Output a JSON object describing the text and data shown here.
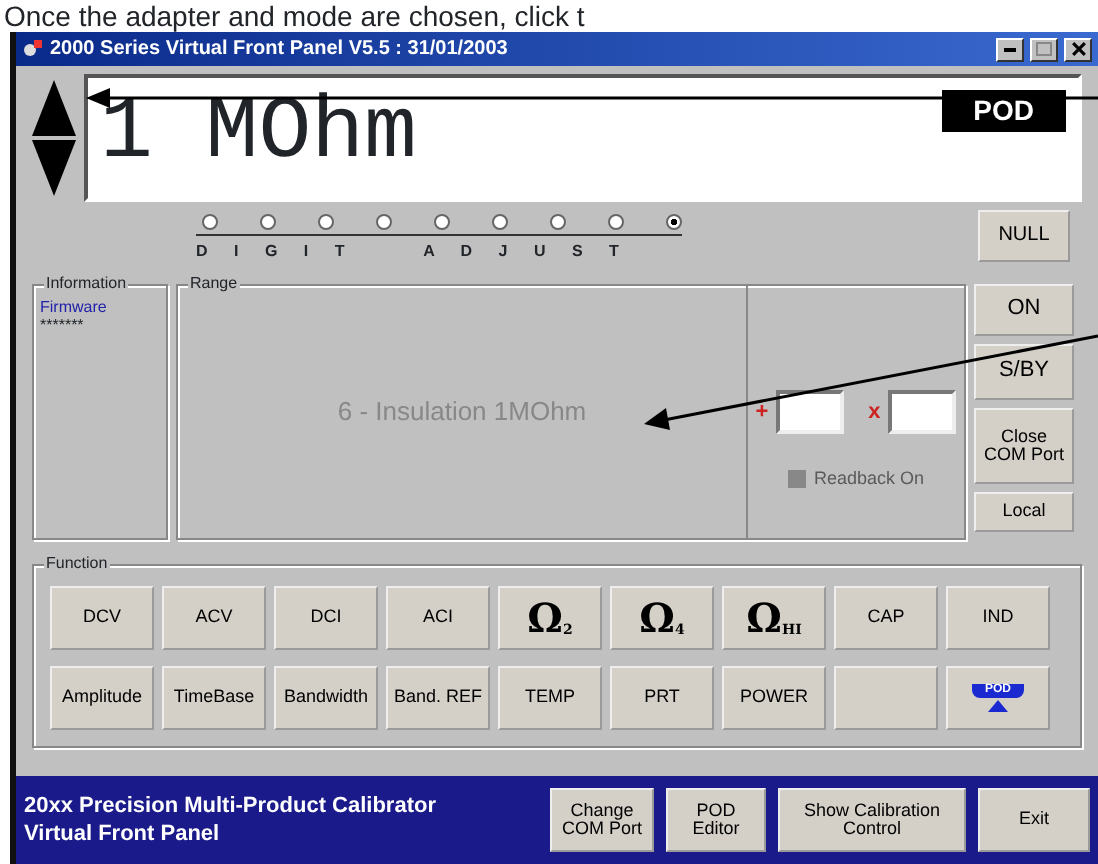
{
  "caption": "Once the adapter and mode are chosen, click t",
  "window": {
    "title": "2000 Series Virtual Front Panel V5.5 : 31/01/2003"
  },
  "display": {
    "reading": "1 MOhm",
    "badge": "POD"
  },
  "digit_adjust": {
    "label": "D I G I T   A D J U S T",
    "radios": [
      {
        "selected": false
      },
      {
        "selected": false
      },
      {
        "selected": false
      },
      {
        "selected": false
      },
      {
        "selected": false
      },
      {
        "selected": false
      },
      {
        "selected": false
      },
      {
        "selected": false
      },
      {
        "selected": true
      }
    ]
  },
  "null_button": "NULL",
  "information": {
    "title": "Information",
    "link": "Firmware",
    "value": "*******"
  },
  "range": {
    "title": "Range",
    "text": "6 - Insulation 1MOhm",
    "plus_marker": "+",
    "times_marker": "x",
    "readback": {
      "label": "Readback On",
      "checked": true,
      "disabled": true
    }
  },
  "side_buttons": [
    "ON",
    "S/BY",
    "Close COM Port",
    "Local"
  ],
  "function": {
    "title": "Function",
    "buttons": [
      {
        "kind": "text",
        "label": "DCV"
      },
      {
        "kind": "text",
        "label": "ACV"
      },
      {
        "kind": "text",
        "label": "DCI"
      },
      {
        "kind": "text",
        "label": "ACI"
      },
      {
        "kind": "ohm",
        "label": "Ω",
        "sub": "2"
      },
      {
        "kind": "ohm",
        "label": "Ω",
        "sub": "4"
      },
      {
        "kind": "ohm",
        "label": "Ω",
        "sub": "HI"
      },
      {
        "kind": "text",
        "label": "CAP"
      },
      {
        "kind": "text",
        "label": "IND"
      },
      {
        "kind": "text",
        "label": "Amplitude"
      },
      {
        "kind": "text",
        "label": "TimeBase"
      },
      {
        "kind": "text",
        "label": "Bandwidth"
      },
      {
        "kind": "text",
        "label": "Band. REF"
      },
      {
        "kind": "text",
        "label": "TEMP"
      },
      {
        "kind": "text",
        "label": "PRT"
      },
      {
        "kind": "text",
        "label": "POWER"
      },
      {
        "kind": "blank"
      },
      {
        "kind": "pod",
        "label": "POD"
      }
    ]
  },
  "footer": {
    "title_lines": [
      "20xx Precision Multi-Product Calibrator",
      "Virtual Front Panel"
    ],
    "buttons": [
      "Change COM Port",
      "POD Editor",
      "Show Calibration Control",
      "Exit"
    ]
  }
}
